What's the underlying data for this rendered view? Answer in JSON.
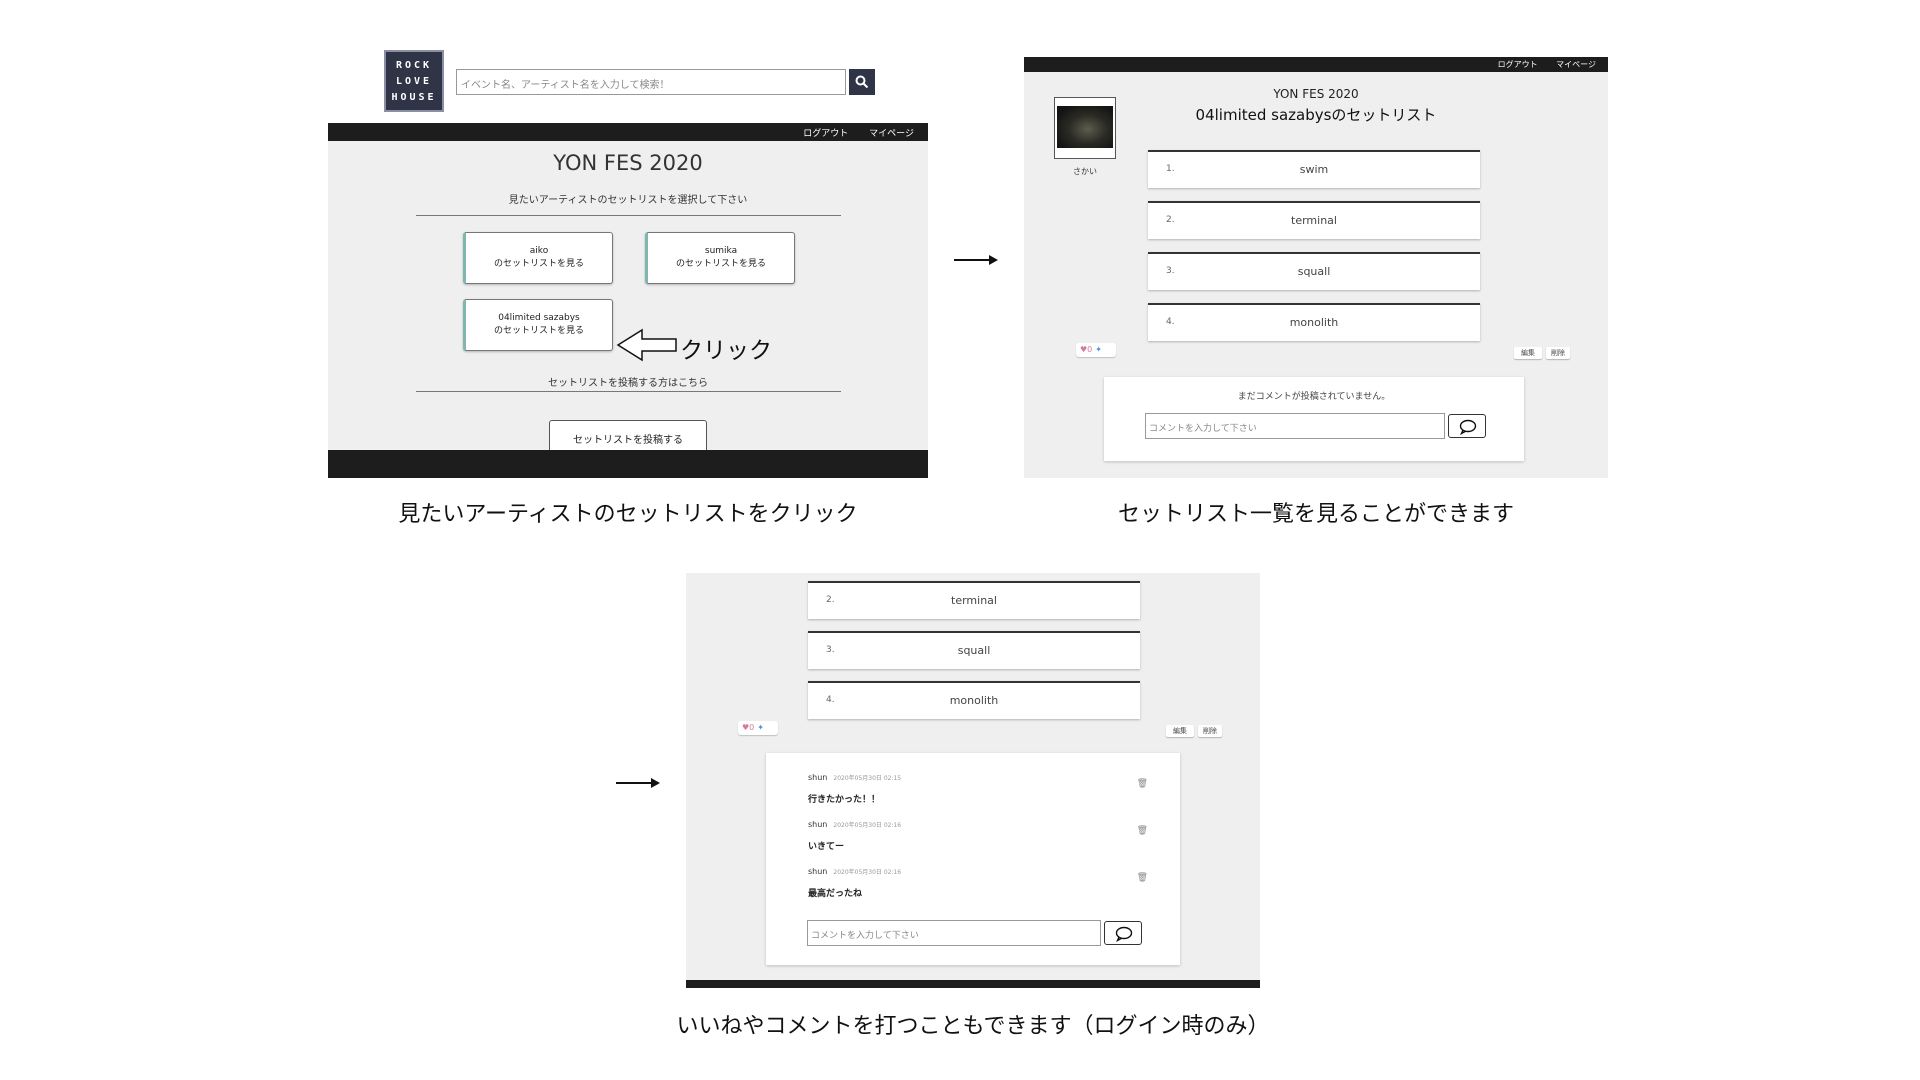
{
  "panel1": {
    "logo_lines": [
      "ROCK",
      "LOVE",
      "HOUSE"
    ],
    "search_placeholder": "イベント名、アーティスト名を入力して検索！",
    "nav": {
      "logout": "ログアウト",
      "mypage": "マイページ"
    },
    "event_title": "YON FES 2020",
    "select_prompt": "見たいアーティストのセットリストを選択して下さい",
    "artists": [
      {
        "name": "aiko",
        "action": "のセットリストを見る"
      },
      {
        "name": "sumika",
        "action": "のセットリストを見る"
      },
      {
        "name": "04limited sazabys",
        "action": "のセットリストを見る"
      }
    ],
    "click_label": "クリック",
    "post_prompt": "セットリストを投稿する方はこちら",
    "post_button": "セットリストを投稿する"
  },
  "panel2": {
    "nav": {
      "logout": "ログアウト",
      "mypage": "マイページ"
    },
    "user_name": "さかい",
    "event_title": "YON FES 2020",
    "setlist_title": "04limited sazabysのセットリスト",
    "songs": [
      {
        "num": "1.",
        "name": "swim"
      },
      {
        "num": "2.",
        "name": "terminal"
      },
      {
        "num": "3.",
        "name": "squall"
      },
      {
        "num": "4.",
        "name": "monolith"
      }
    ],
    "likes": "0",
    "edit_label": "編集",
    "delete_label": "削除",
    "no_comments": "まだコメントが投稿されていません。",
    "comment_placeholder": "コメントを入力して下さい"
  },
  "panel3": {
    "songs": [
      {
        "num": "2.",
        "name": "terminal"
      },
      {
        "num": "3.",
        "name": "squall"
      },
      {
        "num": "4.",
        "name": "monolith"
      }
    ],
    "likes": "0",
    "edit_label": "編集",
    "delete_label": "削除",
    "comments": [
      {
        "user": "shun",
        "date": "2020年05月30日 02:15",
        "text": "行きたかった！！"
      },
      {
        "user": "shun",
        "date": "2020年05月30日 02:16",
        "text": "いきてー"
      },
      {
        "user": "shun",
        "date": "2020年05月30日 02:16",
        "text": "最高だったね"
      }
    ],
    "comment_placeholder": "コメントを入力して下さい"
  },
  "captions": {
    "caption1": "見たいアーティストのセットリストをクリック",
    "caption2": "セットリスト一覧を見ることができます",
    "caption3": "いいねやコメントを打つこともできます（ログイン時のみ）"
  },
  "colors": {
    "header_dark": "#1d1d1d",
    "logo_bg": "#2f3447",
    "panel_bg": "#efefef",
    "button_accent": "#7fb6b0",
    "like_pink": "#d67a9a",
    "twitter_blue": "#4a90e2"
  }
}
